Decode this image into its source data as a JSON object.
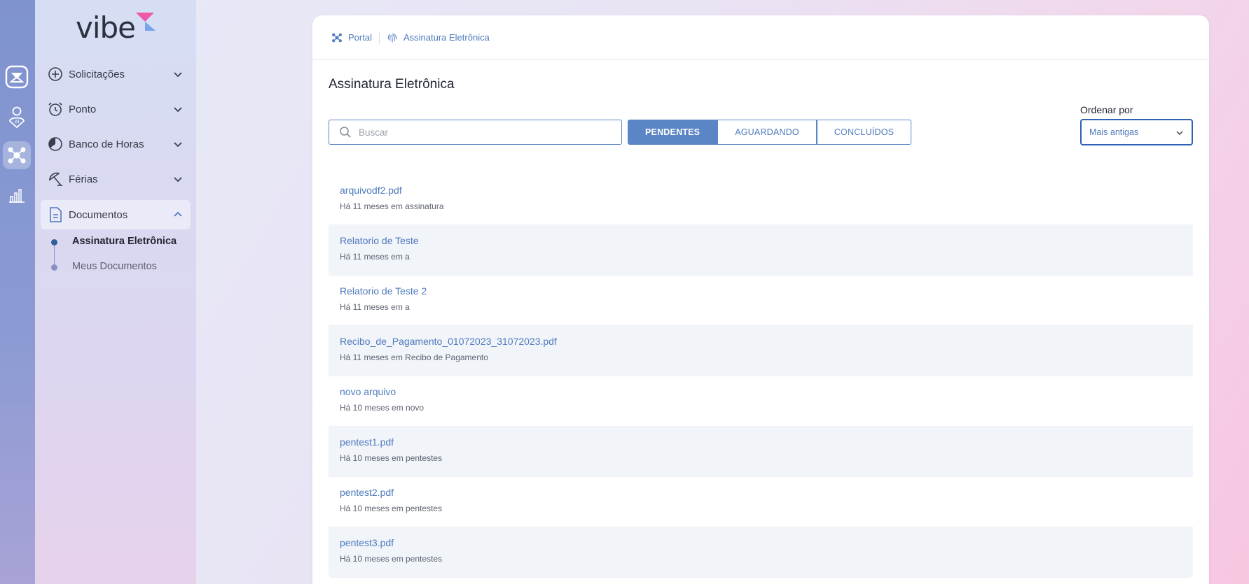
{
  "brand": {
    "logo_text": "vibe"
  },
  "rail": {
    "items": [
      {
        "icon": "app-logo-icon"
      },
      {
        "icon": "person-ai-icon"
      },
      {
        "icon": "portal-network-icon",
        "active": true
      },
      {
        "icon": "bar-chart-icon"
      }
    ]
  },
  "sidebar": {
    "items": [
      {
        "label": "Solicitações",
        "icon": "plus-circle-icon"
      },
      {
        "label": "Ponto",
        "icon": "alarm-clock-icon"
      },
      {
        "label": "Banco de Horas",
        "icon": "pie-clock-icon"
      },
      {
        "label": "Férias",
        "icon": "beach-umbrella-icon"
      },
      {
        "label": "Documentos",
        "icon": "document-icon",
        "expanded": true
      }
    ],
    "subitems": [
      {
        "label": "Assinatura Eletrônica",
        "active": true
      },
      {
        "label": "Meus Documentos",
        "active": false
      }
    ]
  },
  "breadcrumb": {
    "items": [
      {
        "label": "Portal",
        "icon": "portal-network-icon"
      },
      {
        "label": "Assinatura Eletrônica",
        "icon": "fingerprint-icon"
      }
    ]
  },
  "main": {
    "title": "Assinatura Eletrônica",
    "search": {
      "placeholder": "Buscar",
      "value": ""
    },
    "tabs": [
      {
        "label": "PENDENTES",
        "active": true
      },
      {
        "label": "AGUARDANDO",
        "active": false
      },
      {
        "label": "CONCLUÍDOS",
        "active": false
      }
    ],
    "order": {
      "label": "Ordenar por",
      "selected": "Mais antigas"
    },
    "documents": [
      {
        "name": "arquivodf2.pdf",
        "meta": "Há 11 meses em assinatura"
      },
      {
        "name": "Relatorio de Teste",
        "meta": "Há 11 meses em a"
      },
      {
        "name": "Relatorio de Teste 2",
        "meta": "Há 11 meses em a"
      },
      {
        "name": "Recibo_de_Pagamento_01072023_31072023.pdf",
        "meta": "Há 11 meses em Recibo de Pagamento"
      },
      {
        "name": "novo arquivo",
        "meta": "Há 10 meses em novo"
      },
      {
        "name": "pentest1.pdf",
        "meta": "Há 10 meses em pentestes"
      },
      {
        "name": "pentest2.pdf",
        "meta": "Há 10 meses em pentestes"
      },
      {
        "name": "pentest3.pdf",
        "meta": "Há 10 meses em pentestes"
      }
    ]
  },
  "colors": {
    "accent": "#5b86c5",
    "link": "#4f7bbd",
    "logo_pink": "#ec5aa9",
    "logo_blue": "#7aa5e8"
  }
}
